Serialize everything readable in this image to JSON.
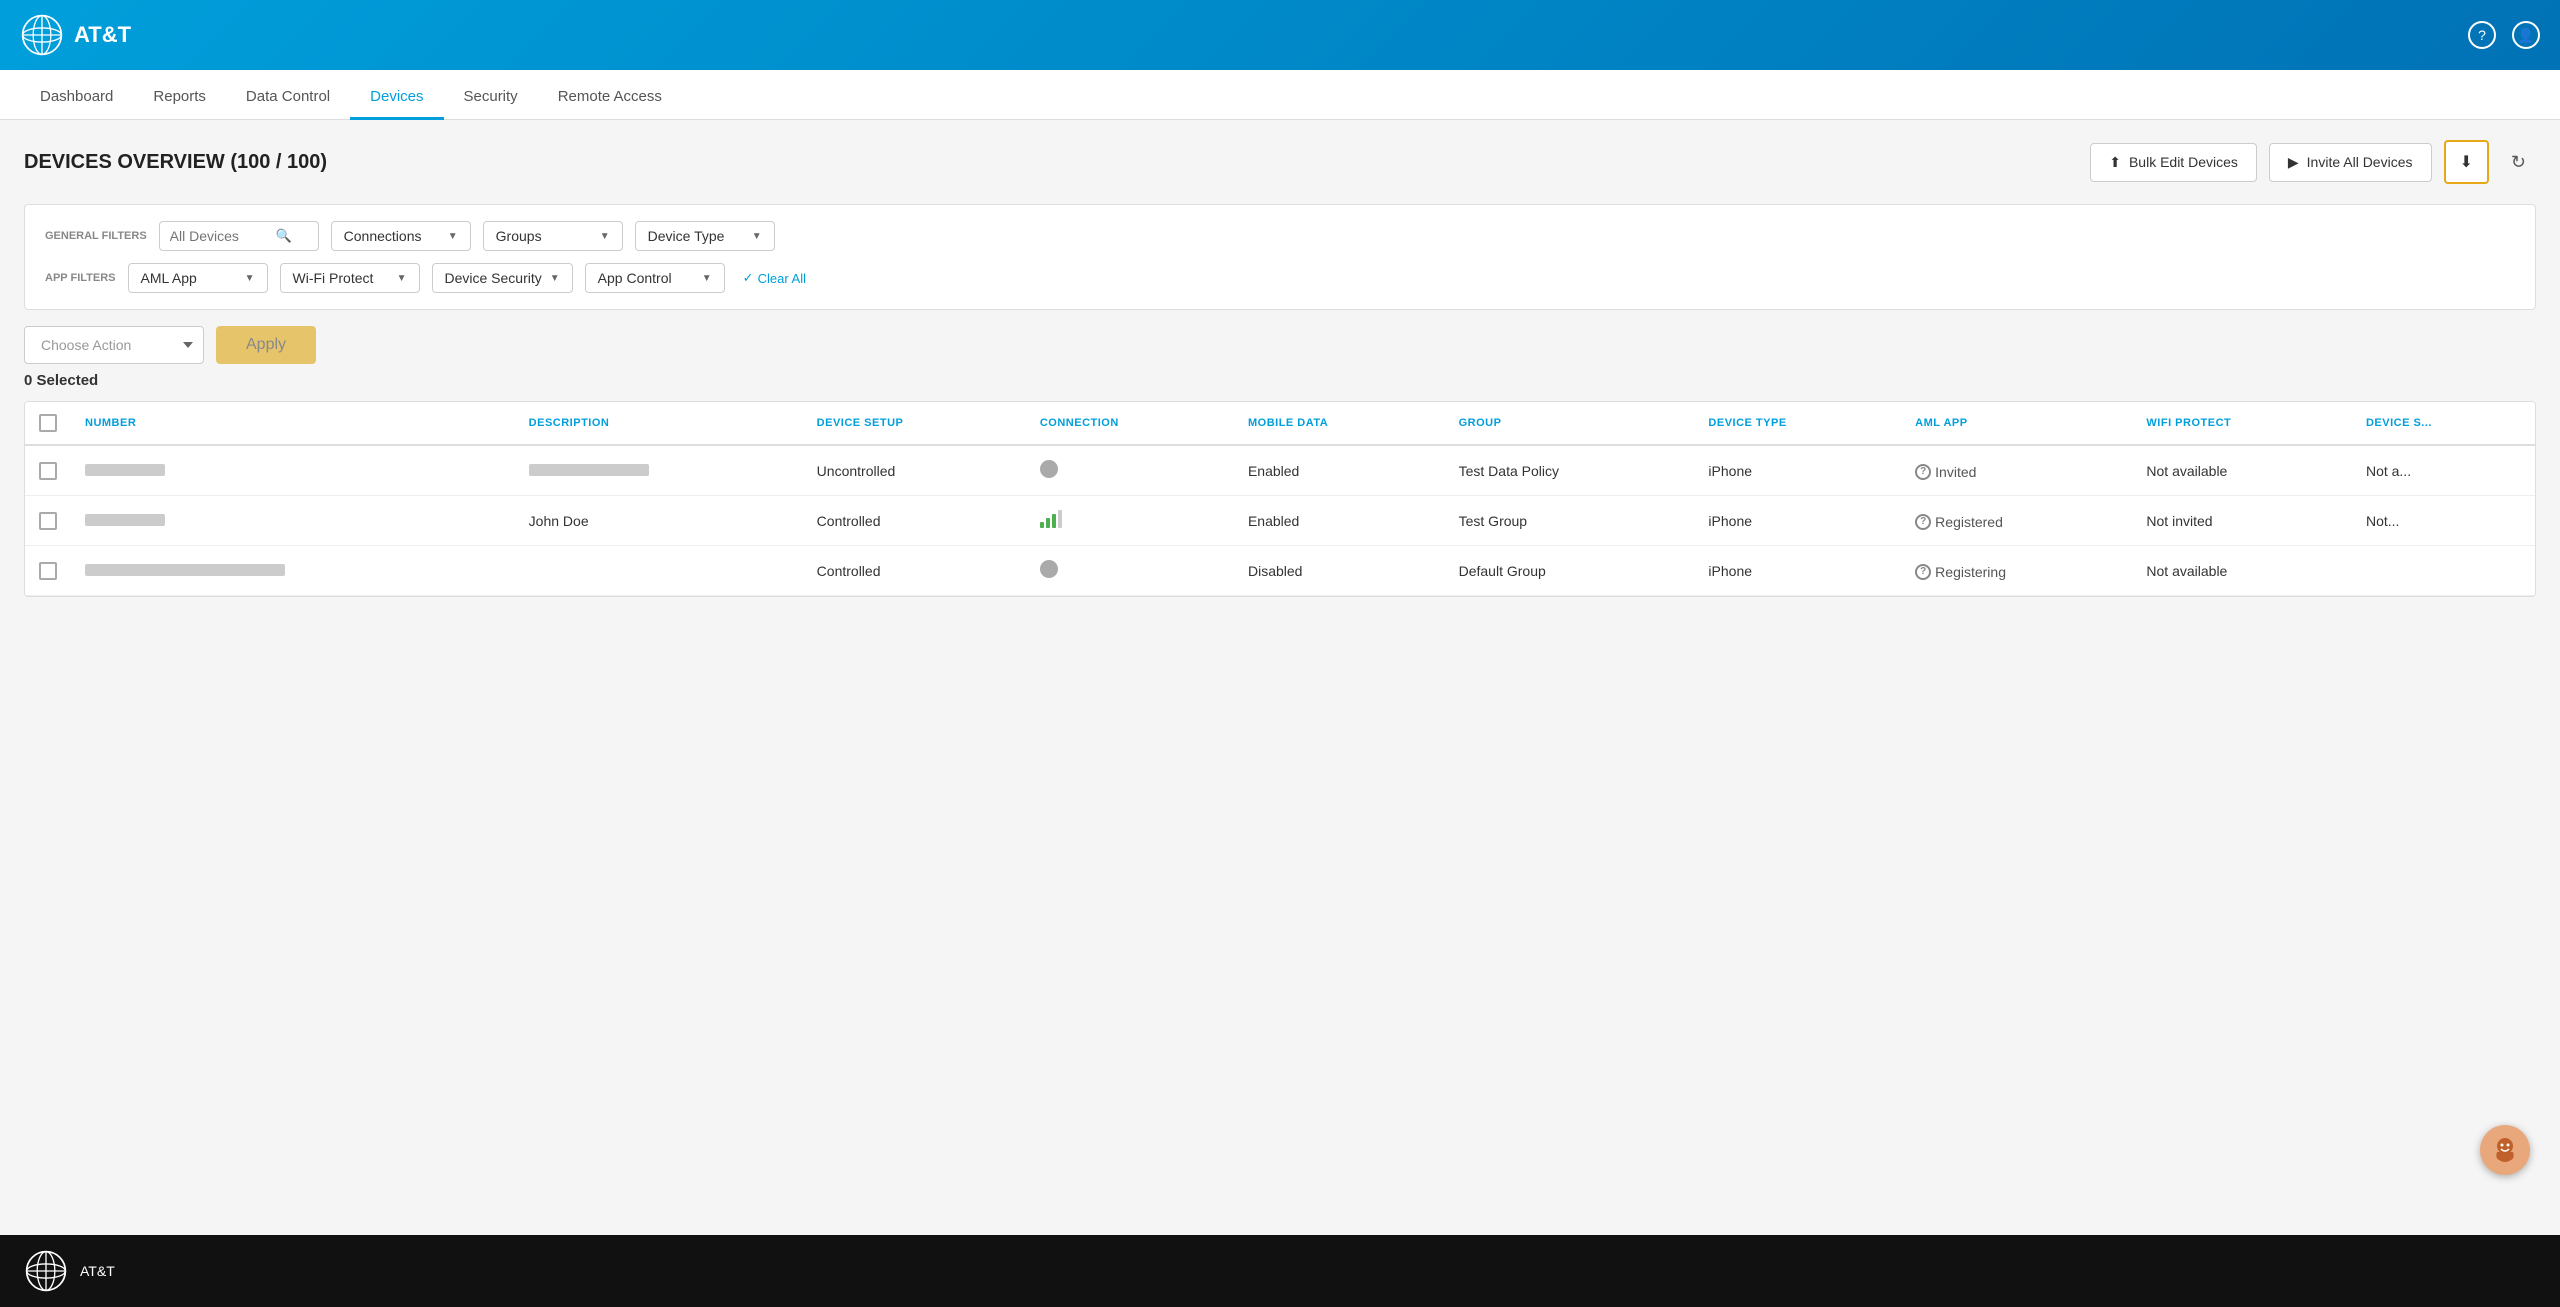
{
  "header": {
    "brand": "AT&T",
    "icons": {
      "help": "?",
      "user": "👤"
    }
  },
  "nav": {
    "items": [
      {
        "label": "Dashboard",
        "active": false
      },
      {
        "label": "Reports",
        "active": false
      },
      {
        "label": "Data Control",
        "active": false
      },
      {
        "label": "Devices",
        "active": true
      },
      {
        "label": "Security",
        "active": false
      },
      {
        "label": "Remote Access",
        "active": false
      }
    ]
  },
  "page": {
    "title": "DEVICES OVERVIEW (100 / 100)"
  },
  "actions": {
    "bulk_edit_label": "Bulk Edit Devices",
    "invite_all_label": "Invite All Devices",
    "download_icon": "⬇",
    "refresh_icon": "↻"
  },
  "filters": {
    "general_label": "GENERAL FILTERS",
    "app_label": "APP FILTERS",
    "search_placeholder": "All Devices",
    "connections_label": "Connections",
    "groups_label": "Groups",
    "device_type_label": "Device Type",
    "aml_app_label": "AML App",
    "wifi_protect_label": "Wi-Fi Protect",
    "device_security_label": "Device Security",
    "app_control_label": "App Control",
    "clear_all_label": "Clear All"
  },
  "bulk_action": {
    "choose_action_placeholder": "Choose Action",
    "apply_label": "Apply"
  },
  "table": {
    "selected_count": "0",
    "selected_label": "Selected",
    "columns": [
      {
        "key": "checkbox",
        "label": ""
      },
      {
        "key": "number",
        "label": "NUMBER"
      },
      {
        "key": "description",
        "label": "DESCRIPTION"
      },
      {
        "key": "device_setup",
        "label": "DEVICE SETUP"
      },
      {
        "key": "connection",
        "label": "CONNECTION"
      },
      {
        "key": "mobile_data",
        "label": "MOBILE DATA"
      },
      {
        "key": "group",
        "label": "GROUP"
      },
      {
        "key": "device_type",
        "label": "DEVICE TYPE"
      },
      {
        "key": "aml_app",
        "label": "AML APP"
      },
      {
        "key": "wifi_protect",
        "label": "WIFI PROTECT"
      },
      {
        "key": "device_security",
        "label": "DEVICE S..."
      }
    ],
    "rows": [
      {
        "number": "redacted",
        "description": "redacted",
        "device_setup": "Uncontrolled",
        "connection": "gray",
        "mobile_data": "Enabled",
        "group": "Test Data Policy",
        "device_type": "iPhone",
        "aml_app_status": "Invited",
        "wifi_protect": "Not available",
        "device_security": "Not a..."
      },
      {
        "number": "redacted",
        "description": "John Doe",
        "device_setup": "Controlled",
        "connection": "signal",
        "mobile_data": "Enabled",
        "group": "Test Group",
        "device_type": "iPhone",
        "aml_app_status": "Registered",
        "wifi_protect": "Not invited",
        "device_security": "Not..."
      },
      {
        "number": "redacted-lg",
        "description": "",
        "device_setup": "Controlled",
        "connection": "gray",
        "mobile_data": "Disabled",
        "group": "Default Group",
        "device_type": "iPhone",
        "aml_app_status": "Registering",
        "wifi_protect": "Not available",
        "device_security": ""
      }
    ]
  },
  "footer": {
    "brand": "AT&T"
  },
  "colors": {
    "att_blue": "#009fdb",
    "download_btn_border": "#e6a817",
    "apply_btn_bg": "#e6c56a",
    "signal_green": "#4caf50",
    "dot_gray": "#aaa"
  }
}
